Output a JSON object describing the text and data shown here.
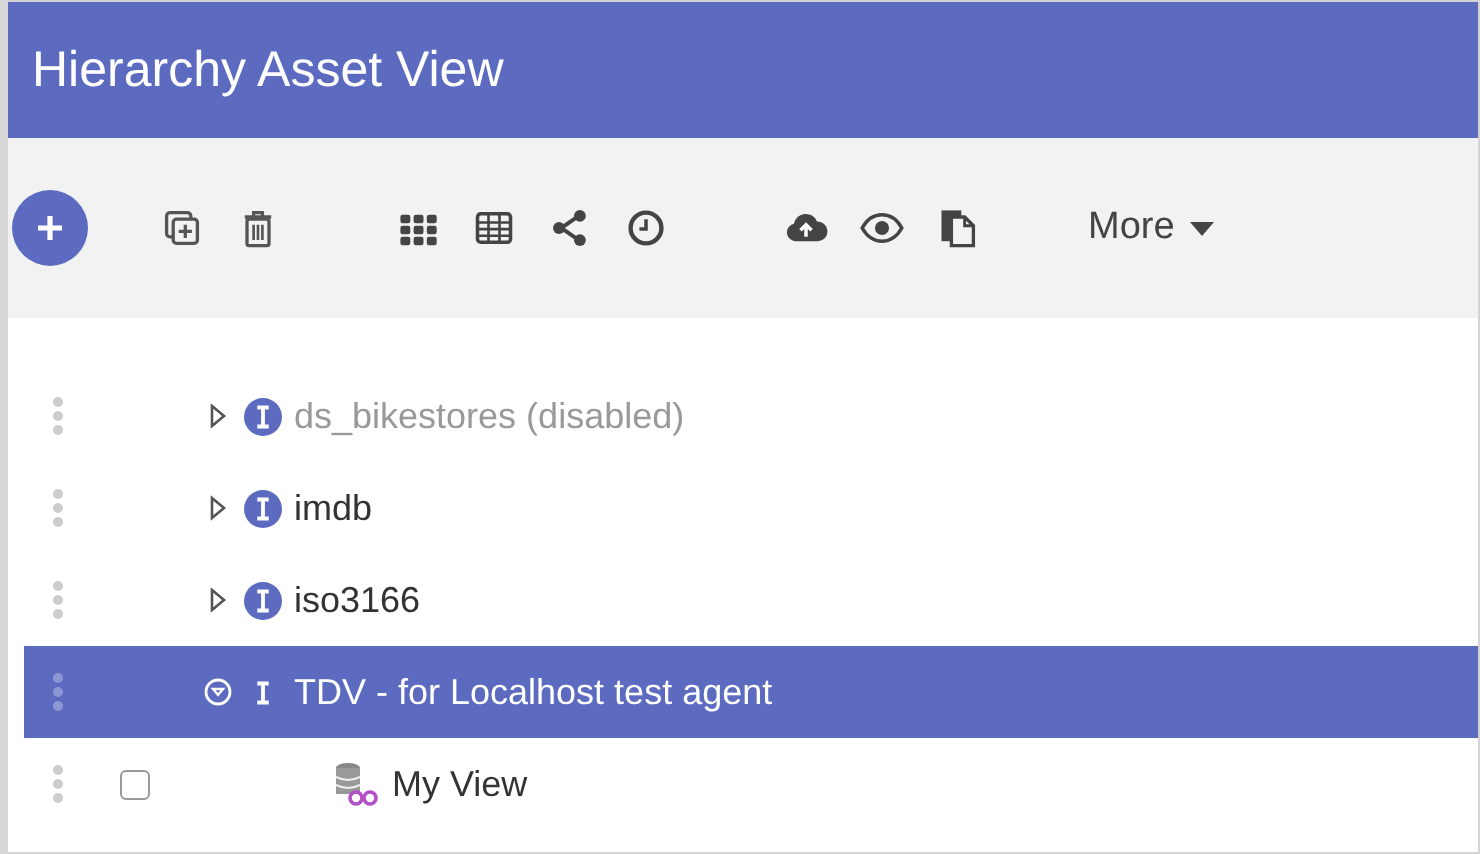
{
  "header": {
    "title": "Hierarchy Asset View"
  },
  "toolbar": {
    "more_label": "More"
  },
  "tree": [
    {
      "label": "ds_bikestores (disabled)",
      "kind": "source",
      "disabled": true,
      "expanded": false,
      "selected": false
    },
    {
      "label": "imdb",
      "kind": "source",
      "disabled": false,
      "expanded": false,
      "selected": false
    },
    {
      "label": "iso3166",
      "kind": "source",
      "disabled": false,
      "expanded": false,
      "selected": false
    },
    {
      "label": "TDV - for Localhost test agent",
      "kind": "source",
      "disabled": false,
      "expanded": true,
      "selected": true,
      "children": [
        {
          "label": "My View",
          "kind": "view",
          "disabled": false,
          "selected": false,
          "checked": false
        }
      ]
    }
  ]
}
